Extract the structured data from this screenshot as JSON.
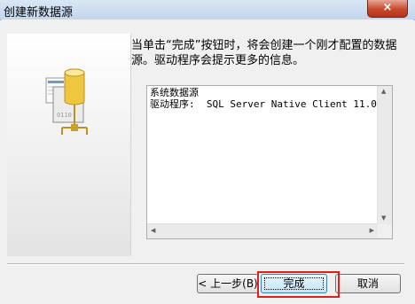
{
  "window": {
    "title": "创建新数据源",
    "close_glyph": "×"
  },
  "description": "当单击“完成”按钮时，将会创建一个刚才配置的数据源。驱动程序会提示更多的信息。",
  "summary": {
    "lines": [
      "系统数据源",
      "驱动程序:  SQL Server Native Client 11.0"
    ]
  },
  "buttons": {
    "back": "< 上一步(B)",
    "finish": "完成",
    "cancel": "取消"
  },
  "icons": {
    "left_illustration": "database-datasource-icon"
  },
  "colors": {
    "highlight": "#e02020",
    "titlebar": "#c3d6ee"
  }
}
